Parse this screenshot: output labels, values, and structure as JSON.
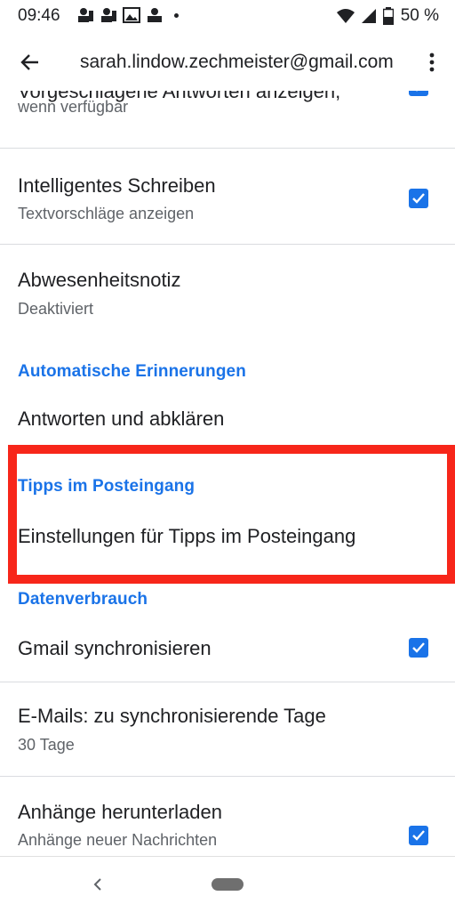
{
  "status": {
    "time": "09:46",
    "battery": "50 %"
  },
  "appbar": {
    "title": "sarah.lindow.zechmeister@gmail.com"
  },
  "settings": {
    "row0": {
      "title": "Vorgeschlagene Antworten anzeigen,",
      "subtitle": "wenn verfügbar",
      "checked": true
    },
    "row1": {
      "title": "Intelligentes Schreiben",
      "subtitle": "Textvorschläge anzeigen",
      "checked": true
    },
    "row2": {
      "title": "Abwesenheitsnotiz",
      "subtitle": "Deaktiviert"
    },
    "section1": "Automatische Erinnerungen",
    "row3": {
      "title": "Antworten und abklären"
    },
    "section2": "Tipps im Posteingang",
    "row4": {
      "title": "Einstellungen für Tipps im Posteingang"
    },
    "section3": "Datenverbrauch",
    "row5": {
      "title": "Gmail synchronisieren",
      "checked": true
    },
    "row6": {
      "title": "E-Mails: zu synchronisierende Tage",
      "subtitle": "30 Tage"
    },
    "row7": {
      "title": "Anhänge herunterladen",
      "subtitle": "Anhänge neuer Nachrichten",
      "checked": true
    }
  },
  "colors": {
    "accent": "#1a73e8",
    "highlight": "#f7261a"
  }
}
